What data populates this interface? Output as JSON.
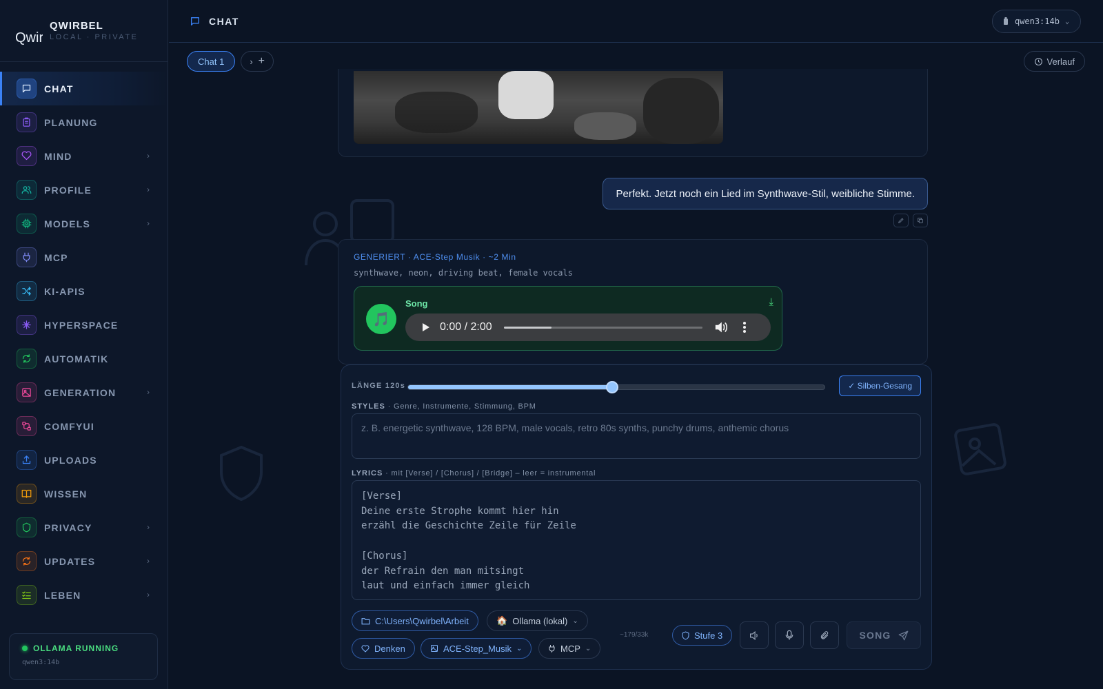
{
  "brand": {
    "logo_alt": "Qwir",
    "name": "QWIRBEL",
    "subtitle": "LOCAL · PRIVATE"
  },
  "nav": {
    "items": [
      {
        "label": "CHAT",
        "icon": "chat-icon",
        "color": "#3b82f6",
        "active": true,
        "chevron": false
      },
      {
        "label": "PLANUNG",
        "icon": "clipboard-icon",
        "color": "#8b5cf6",
        "chevron": false
      },
      {
        "label": "MIND",
        "icon": "heart-icon",
        "color": "#a855f7",
        "chevron": true
      },
      {
        "label": "PROFILE",
        "icon": "users-icon",
        "color": "#14b8a6",
        "chevron": true
      },
      {
        "label": "MODELS",
        "icon": "cpu-icon",
        "color": "#10b981",
        "chevron": true
      },
      {
        "label": "MCP",
        "icon": "plug-icon",
        "color": "#818cf8",
        "chevron": false
      },
      {
        "label": "KI-APIS",
        "icon": "shuffle-icon",
        "color": "#38bdf8",
        "chevron": false
      },
      {
        "label": "HYPERSPACE",
        "icon": "sparkle-icon",
        "color": "#8b5cf6",
        "chevron": false
      },
      {
        "label": "AUTOMATIK",
        "icon": "refresh-icon",
        "color": "#22c55e",
        "chevron": false
      },
      {
        "label": "GENERATION",
        "icon": "image-icon",
        "color": "#ec4899",
        "chevron": true
      },
      {
        "label": "COMFYUI",
        "icon": "workflow-icon",
        "color": "#ec4899",
        "chevron": false
      },
      {
        "label": "UPLOADS",
        "icon": "upload-icon",
        "color": "#3b82f6",
        "chevron": false
      },
      {
        "label": "WISSEN",
        "icon": "book-icon",
        "color": "#f59e0b",
        "chevron": false
      },
      {
        "label": "PRIVACY",
        "icon": "shield-icon",
        "color": "#22c55e",
        "chevron": true
      },
      {
        "label": "UPDATES",
        "icon": "refresh-icon",
        "color": "#f97316",
        "chevron": true
      },
      {
        "label": "LEBEN",
        "icon": "list-check-icon",
        "color": "#84cc16",
        "chevron": true
      }
    ]
  },
  "status": {
    "label": "OLLAMA RUNNING",
    "model": "qwen3:14b"
  },
  "header": {
    "title": "CHAT",
    "model": "qwen3:14b"
  },
  "tabs": {
    "active": "Chat 1",
    "verlauf": "Verlauf"
  },
  "messages": {
    "user": "Perfekt. Jetzt noch ein Lied im Synthwave-Stil, weibliche Stimme.",
    "generated_line": "GENERIERT · ACE-Step Musik · ~2 Min",
    "generated_tags": "synthwave, neon, driving beat, female vocals",
    "song_title": "Song",
    "audio_time": "0:00 / 2:00",
    "audio_progress": 0.24
  },
  "composer": {
    "length_label": "LÄNGE 120s",
    "length_value": 0.49,
    "silben": "✓ Silben-Gesang",
    "styles_label_bold": "STYLES",
    "styles_label_rest": " · Genre, Instrumente, Stimmung, BPM",
    "styles_placeholder": "z. B. energetic synthwave, 128 BPM, male vocals, retro 80s synths, punchy drums, anthemic chorus",
    "lyrics_label_bold": "LYRICS",
    "lyrics_label_rest": " · mit [Verse] / [Chorus] / [Bridge] – leer = instrumental",
    "lyrics": "[Verse]\nDeine erste Strophe kommt hier hin\nerzähl die Geschichte Zeile für Zeile\n\n[Chorus]\nder Refrain den man mitsingt\nlaut und einfach immer gleich",
    "folder": "C:\\Users\\Qwirbel\\Arbeit",
    "provider": "Ollama (lokal)",
    "denken": "Denken",
    "tool": "ACE-Step_Musik",
    "mcp": "MCP",
    "counter": "~179/33k",
    "stufe": "Stufe 3",
    "send": "SONG"
  }
}
